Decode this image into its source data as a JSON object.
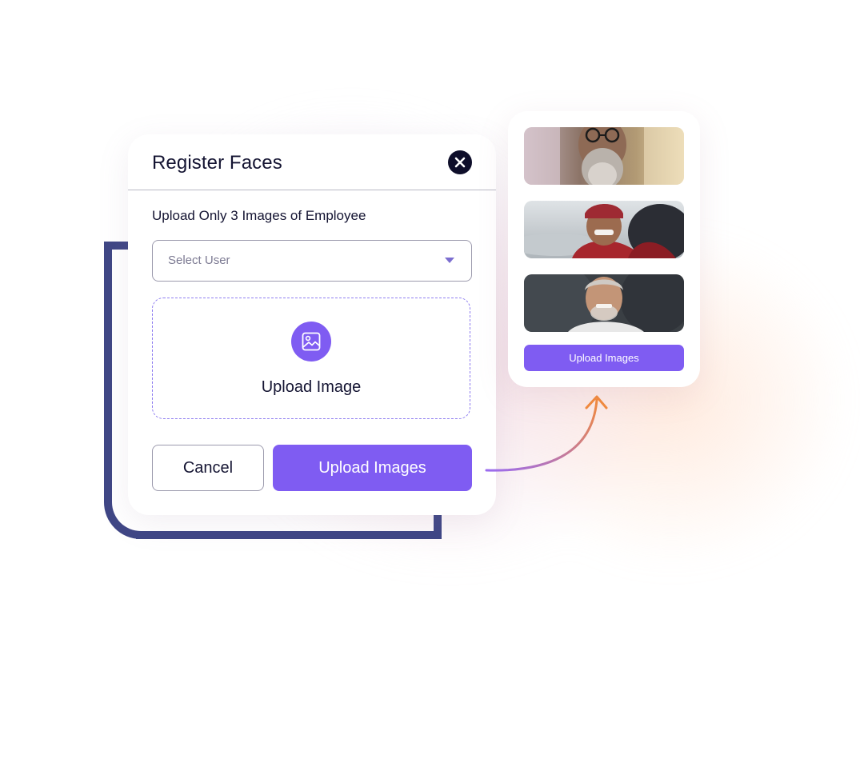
{
  "dialog": {
    "title": "Register Faces",
    "subtitle": "Upload Only 3 Images of Employee",
    "select_placeholder": "Select User",
    "dropzone_label": "Upload Image",
    "cancel_label": "Cancel",
    "upload_label": "Upload Images"
  },
  "preview": {
    "upload_label": "Upload Images"
  },
  "colors": {
    "accent": "#7f5cf2",
    "bracket": "#3f4685",
    "close_button": "#0e0e2a",
    "arrow_start": "#9b6cf0",
    "arrow_end": "#f28a3c"
  },
  "icons": {
    "close": "close-icon",
    "dropdown": "caret-down-icon",
    "image": "image-icon",
    "arrow": "curved-arrow-icon"
  }
}
